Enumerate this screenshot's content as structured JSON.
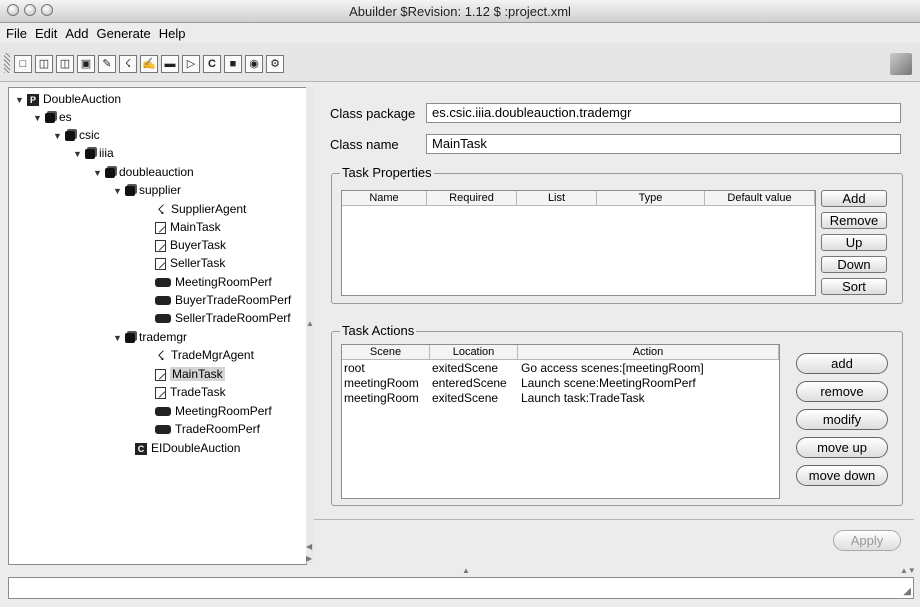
{
  "window": {
    "title": "Abuilder $Revision: 1.12 $ :project.xml"
  },
  "menu": [
    "File",
    "Edit",
    "Add",
    "Generate",
    "Help"
  ],
  "toolbar": {
    "icons": [
      "new-file-icon",
      "open-folder-icon",
      "open-folder-alt-icon",
      "save-icon",
      "edit-icon",
      "agent-icon",
      "task-icon",
      "performative-icon",
      "play-icon",
      "class-icon",
      "package-icon",
      "database-icon",
      "gear-icon"
    ]
  },
  "tree": {
    "nodes": [
      {
        "label": "DoubleAuction",
        "type": "project"
      },
      {
        "label": "es",
        "type": "package"
      },
      {
        "label": "csic",
        "type": "package"
      },
      {
        "label": "iiia",
        "type": "package"
      },
      {
        "label": "doubleauction",
        "type": "package"
      },
      {
        "label": "supplier",
        "type": "package"
      },
      {
        "label": "SupplierAgent",
        "type": "agent"
      },
      {
        "label": "MainTask",
        "type": "task"
      },
      {
        "label": "BuyerTask",
        "type": "task"
      },
      {
        "label": "SellerTask",
        "type": "task"
      },
      {
        "label": "MeetingRoomPerf",
        "type": "performative"
      },
      {
        "label": "BuyerTradeRoomPerf",
        "type": "performative"
      },
      {
        "label": "SellerTradeRoomPerf",
        "type": "performative"
      },
      {
        "label": "trademgr",
        "type": "package"
      },
      {
        "label": "TradeMgrAgent",
        "type": "agent"
      },
      {
        "label": "MainTask",
        "type": "task",
        "selected": true
      },
      {
        "label": "TradeTask",
        "type": "task"
      },
      {
        "label": "MeetingRoomPerf",
        "type": "performative"
      },
      {
        "label": "TradeRoomPerf",
        "type": "performative"
      },
      {
        "label": "EIDoubleAuction",
        "type": "class"
      }
    ]
  },
  "form": {
    "class_package_label": "Class package",
    "class_package_value": "es.csic.iiia.doubleauction.trademgr",
    "class_name_label": "Class name",
    "class_name_value": "MainTask"
  },
  "task_properties": {
    "title": "Task Properties",
    "columns": [
      "Name",
      "Required",
      "List",
      "Type",
      "Default value"
    ],
    "rows": [],
    "buttons": [
      "Add",
      "Remove",
      "Up",
      "Down",
      "Sort"
    ]
  },
  "task_actions": {
    "title": "Task Actions",
    "columns": [
      "Scene",
      "Location",
      "Action"
    ],
    "rows": [
      [
        "root",
        "exitedScene",
        "Go access scenes:[meetingRoom]"
      ],
      [
        "meetingRoom",
        "enteredScene",
        "Launch scene:MeetingRoomPerf"
      ],
      [
        "meetingRoom",
        "exitedScene",
        "Launch task:TradeTask"
      ]
    ],
    "buttons": [
      "add",
      "remove",
      "modify",
      "move up",
      "move down"
    ]
  },
  "apply_label": "Apply"
}
